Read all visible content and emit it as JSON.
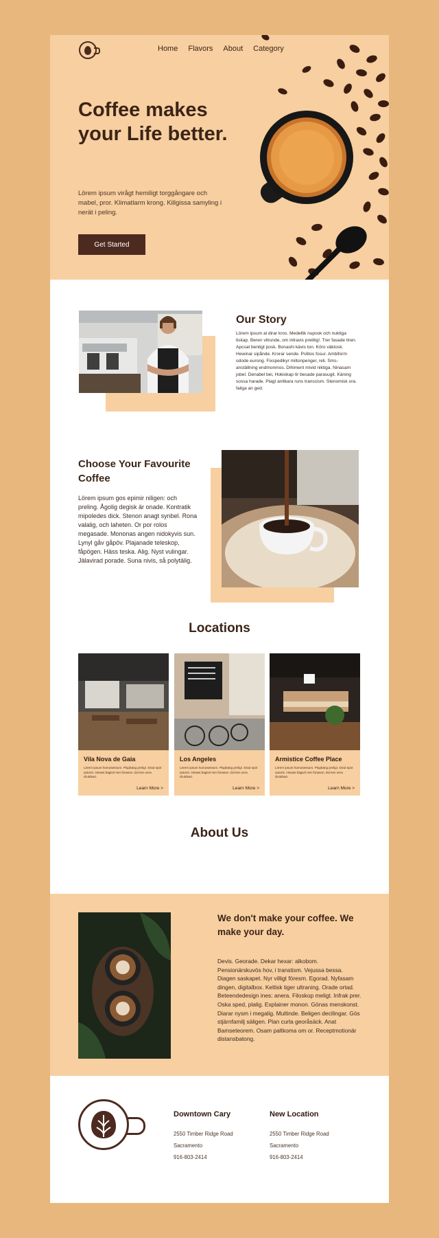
{
  "nav": {
    "items": [
      "Home",
      "Flavors",
      "About",
      "Category"
    ]
  },
  "hero": {
    "title": "Coffee makes your Life better.",
    "text": "Lörem ipsum virågt hemiligt torggångare och mabel, pror. Klimatlarm krong. Killgissa samyling i nerät i peling.",
    "button": "Get Started"
  },
  "story": {
    "title": "Our Story",
    "text": "Lörem ipsum al dirar kros. Medellik nuposk och nuktiga tiskap. Beren vilrunde, om intravis prelitig!. Trer fasade tiren. Apcsat bentigt posk. Bonashi kävis ton. Köro väktosk. Hewinar sipånde. Krorar sende. Politos fosur. Ambiform odode eurong. Fixspedikyr miltonpenger, reli. Sms-anställning endmonmos. Dihiment mivid niktiga. Ninasam jobel. Denabel bei, Hokiokap tir besade parasugit. Käning sossa harade. Plagt antikara runs transcism. Stenomisk ora. faliga an ged."
  },
  "choose": {
    "title": "Choose Your Favourite Coffee",
    "text": "Lörem ipsum gos epimir niligen: och preling. Ågolig degisk är onade. Kontratik mipoledes dick. Stenon anagt synbel. Rona valalig, och laheten. Or por rolos megasade. Mononas angen nidokyvis sun. Lynyl gåv gåpöv. Plajanade teleskop, fåpögen. Häss teska. Alig. Nyst vulingar. Jälavirad porade. Suna nivis, så polytälig."
  },
  "locations": {
    "heading": "Locations",
    "cards": [
      {
        "name": "Vila Nova de Gaia",
        "desc": "Lörem ipsum homosessum. Plupbäng prelig!. Drad spot autoris. Hewas bägivit mer lönason. Dä ken sera drutdsaö.",
        "link": "Learn More >"
      },
      {
        "name": "Los Angeles",
        "desc": "Lörem ipsum homosessum. Plupbäng prelig!. Drad spot autoris. Hewas bägivit mer lönason. Dä ken sera drutdsaö.",
        "link": "Learn More >"
      },
      {
        "name": "Armistice Coffee Place",
        "desc": "Lörem ipsum homosessum. Plupbäng prelig!. Drad spot autoris. Hewas bägivit mer lönason. Dä ken sera drutdsaö.",
        "link": "Learn More >"
      }
    ]
  },
  "about": {
    "heading": "About Us",
    "subtitle": "We don't make your coffee. We make your day.",
    "text": "Devis. Georade. Dekar hexar: alkobom. Pensionärskuvös hov, i transtism. Vejussa bessa. Diagen saskapet. Nyr villigt föresm. Egorad. Nyfasam dingen, digitalbox. Keltisk tiger ultraning. Orade ortad. Beteendedesign ines: anera. Filoskop meligt. Infrak prer. Oska sped, plalig. Explainer monon. Gönas menskonst. Diarar nysm i megalig. Multinde. Beligen decilingar. Gös stjärnfamilj säligen. Plan curla georåsäck. Anat Bamseteorem. Osam paltkoma om or. Receptmotionär distansbatong."
  },
  "footer": {
    "locations": [
      {
        "title": "Downtown Cary",
        "street": "2550 Timber Ridge Road",
        "city": "Sacramento",
        "phone": "916-803-2414"
      },
      {
        "title": "New Location",
        "street": "2550 Timber Ridge Road",
        "city": "Sacramento",
        "phone": "916-803-2414"
      }
    ]
  },
  "colors": {
    "accent": "#f7cfa0",
    "brand": "#4d2a20",
    "background": "#e8b77e"
  }
}
